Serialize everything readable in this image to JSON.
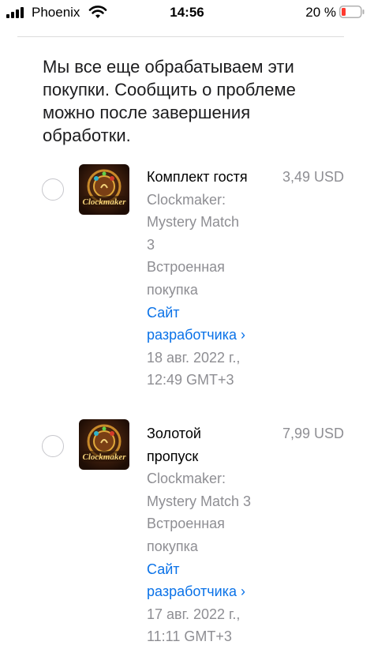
{
  "status_bar": {
    "carrier": "Phoenix",
    "time": "14:56",
    "battery_percent": "20 %",
    "icons": [
      "signal-icon",
      "wifi-icon",
      "battery-icon"
    ]
  },
  "notice": {
    "line1": "Мы все еще обрабатываем эти",
    "line2": "покупки. Сообщить о проблеме",
    "line3": "можно после завершения",
    "line4": "обработки."
  },
  "purchases": [
    {
      "title_lines": [
        "Комплект гостя"
      ],
      "app_lines": [
        "Clockmaker:",
        "Mystery Match",
        "3"
      ],
      "type_lines": [
        "Встроенная",
        "покупка"
      ],
      "link_lines": [
        "Сайт",
        "разработчика ›"
      ],
      "date_lines": [
        "18 авг. 2022 г.,",
        "12:49 GMT+3"
      ],
      "price": "3,49 USD",
      "icon_label": "Clockmaker"
    },
    {
      "title_lines": [
        "Золотой",
        "пропуск"
      ],
      "app_lines": [
        "Clockmaker:",
        "Mystery Match 3"
      ],
      "type_lines": [
        "Встроенная",
        "покупка"
      ],
      "link_lines": [
        "Сайт",
        "разработчика ›"
      ],
      "date_lines": [
        "17 авг. 2022 г.,",
        "11:11 GMT+3"
      ],
      "price": "7,99 USD",
      "icon_label": "Clockmaker"
    }
  ],
  "colors": {
    "link": "#0a72e8",
    "secondary_text": "#8e8e93",
    "battery_low": "#ff3b30"
  }
}
